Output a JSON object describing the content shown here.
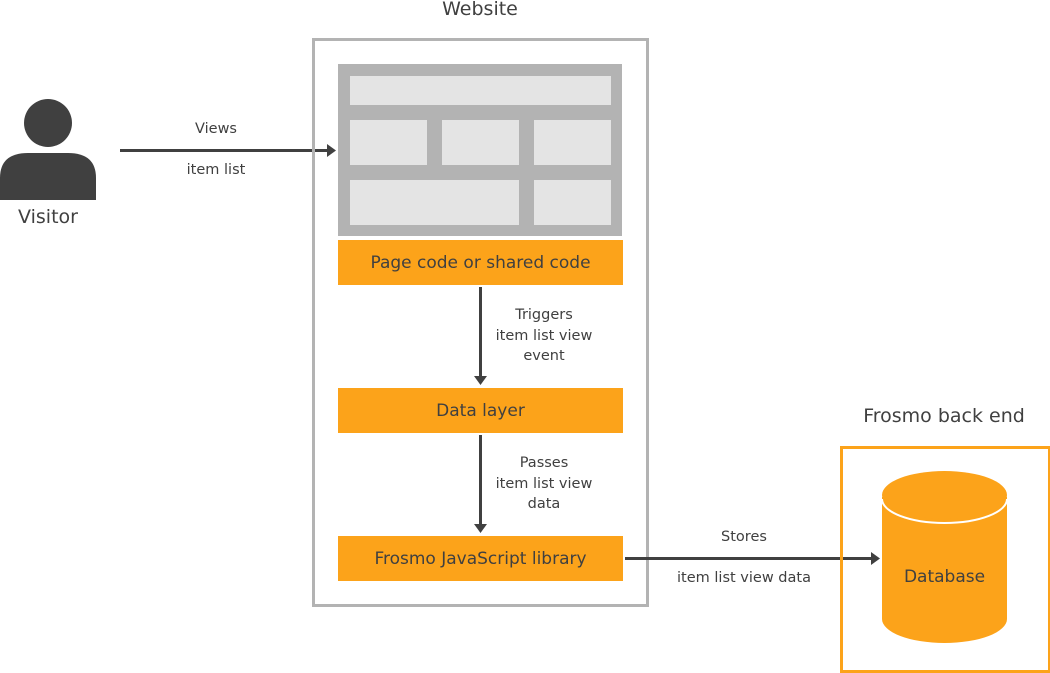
{
  "diagram": {
    "visitor": {
      "label": "Visitor",
      "icon": "person-icon"
    },
    "website": {
      "title": "Website",
      "wireframe_icon": "web-page-layout-icon",
      "components": [
        {
          "id": "page-code",
          "label": "Page code or shared code"
        },
        {
          "id": "data-layer",
          "label": "Data layer"
        },
        {
          "id": "frosmo-js",
          "label": "Frosmo JavaScript library"
        }
      ]
    },
    "backend": {
      "title": "Frosmo back end",
      "database": {
        "label": "Database",
        "icon": "database-icon"
      }
    },
    "arrows": [
      {
        "from": "visitor",
        "to": "website",
        "label_top": "Views",
        "label_bottom": "item list"
      },
      {
        "from": "page-code",
        "to": "data-layer",
        "label": [
          "Triggers",
          "item list view",
          "event"
        ]
      },
      {
        "from": "data-layer",
        "to": "frosmo-js",
        "label": [
          "Passes",
          "item list view",
          "data"
        ]
      },
      {
        "from": "frosmo-js",
        "to": "database",
        "label_top": "Stores",
        "label_bottom": "item list view data"
      }
    ],
    "colors": {
      "accent_orange": "#fca31a",
      "frame_gray": "#b3b3b3",
      "cell_gray": "#e4e4e4",
      "text_dark": "#404040"
    }
  }
}
